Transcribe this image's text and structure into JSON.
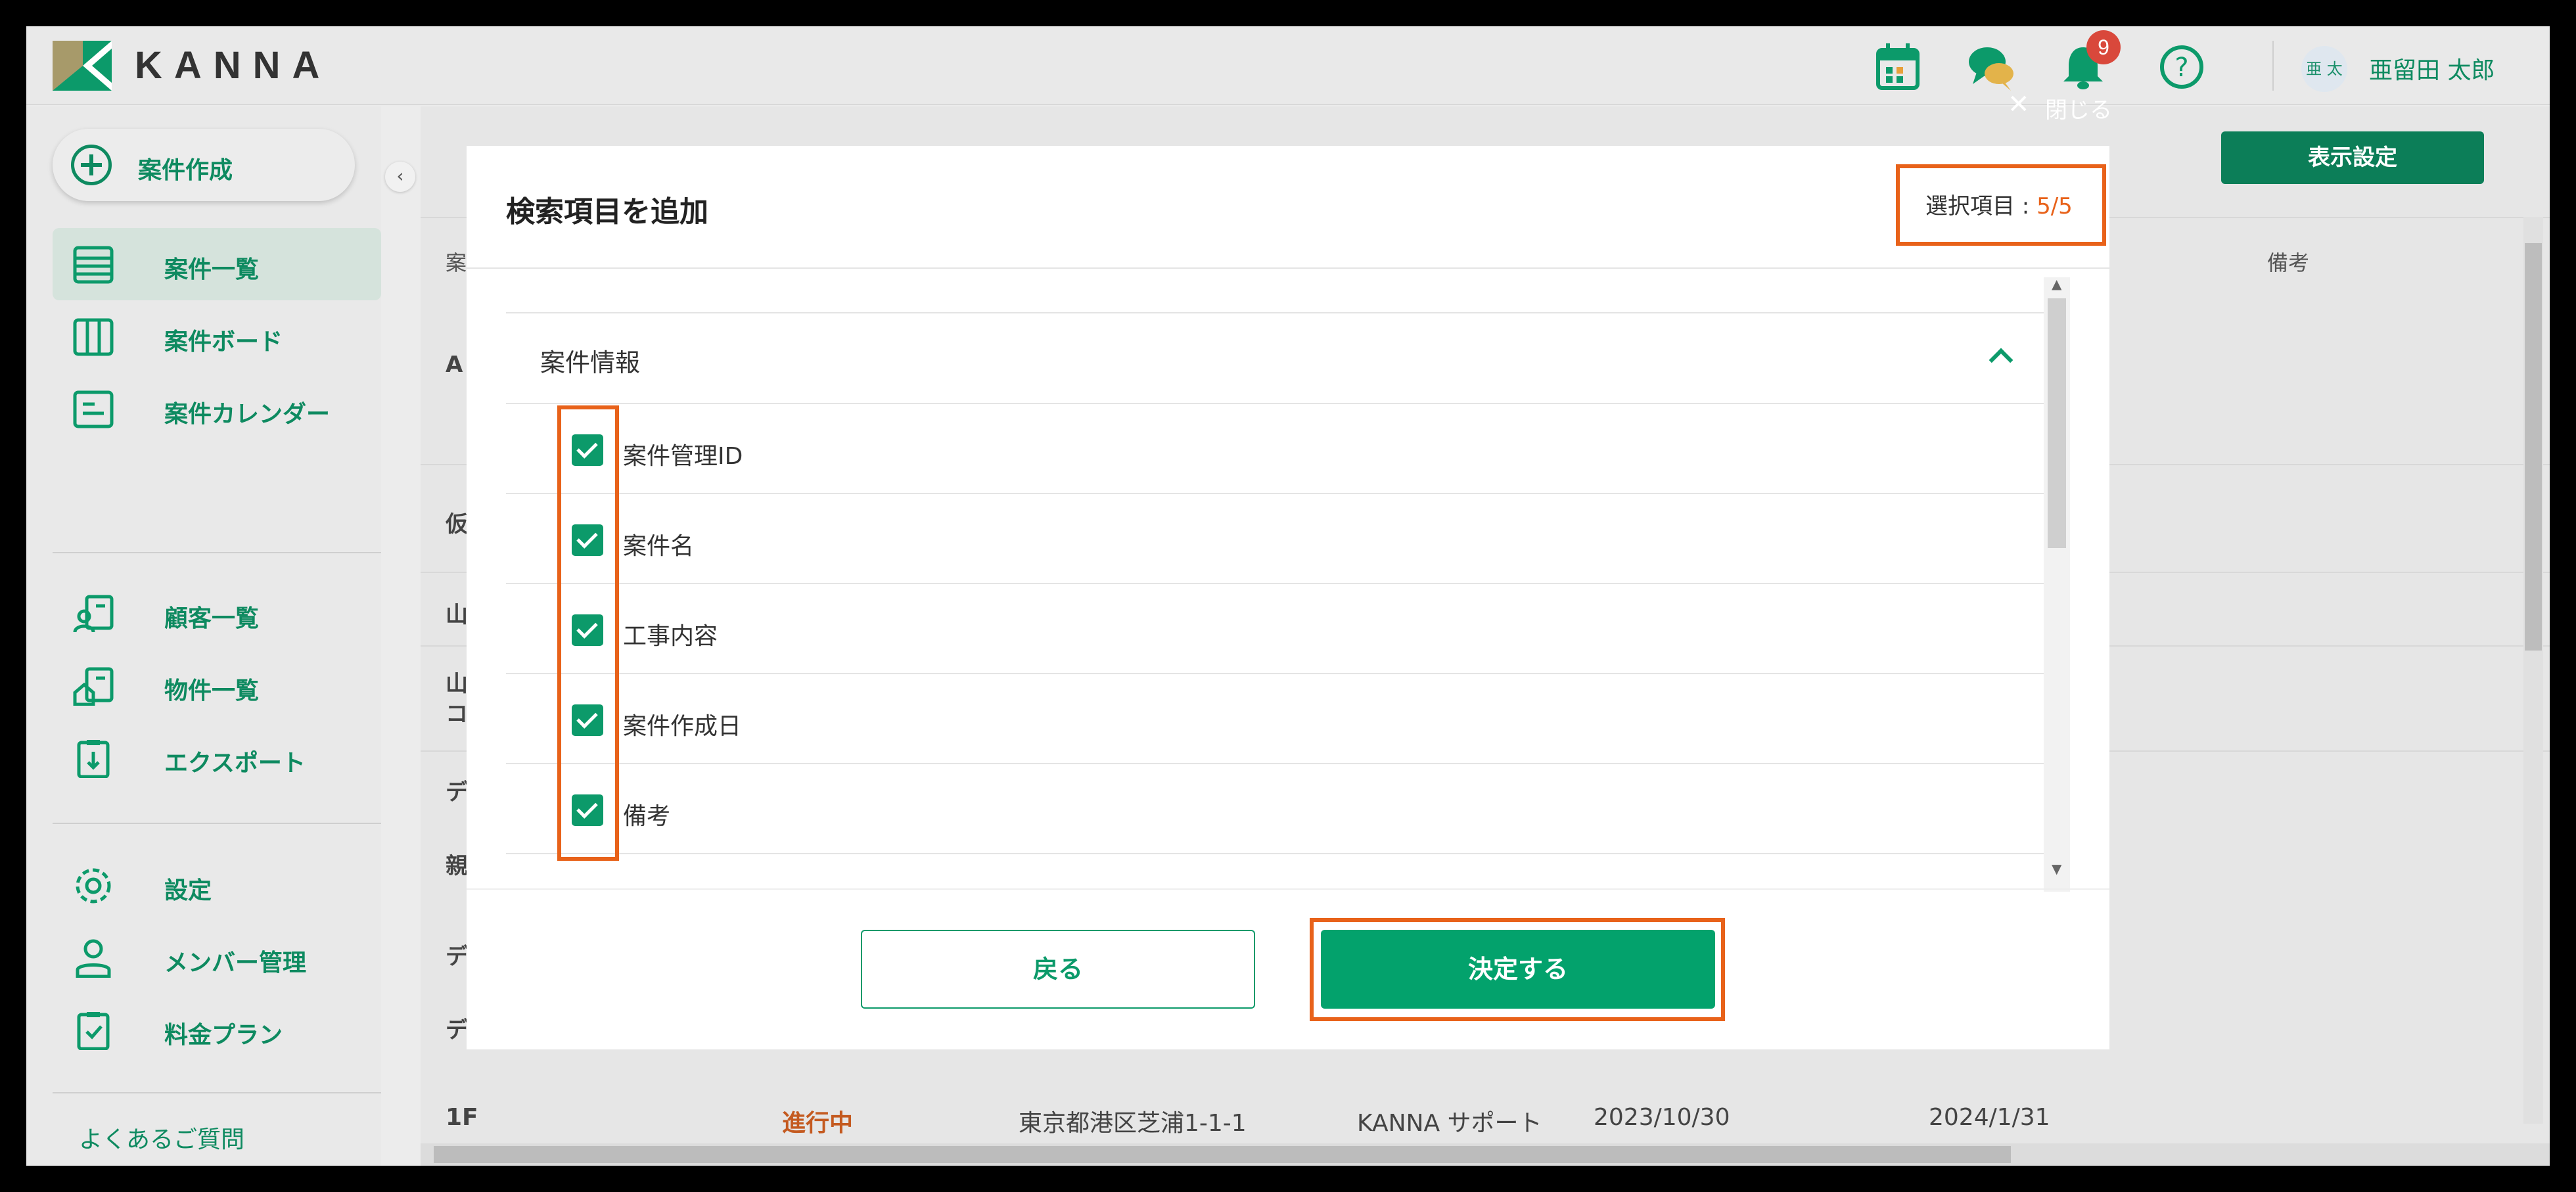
{
  "app": {
    "brand": "KANNA",
    "notification_count": "9",
    "user": {
      "avatar": "亜 太",
      "name": "亜留田 太郎"
    }
  },
  "sidebar": {
    "create": "案件作成",
    "items": [
      {
        "label": "案件一覧",
        "icon": "list-icon"
      },
      {
        "label": "案件ボード",
        "icon": "board-icon"
      },
      {
        "label": "案件カレンダー",
        "icon": "calendar-list-icon"
      },
      {
        "label": "顧客一覧",
        "icon": "customer-icon"
      },
      {
        "label": "物件一覧",
        "icon": "property-icon"
      },
      {
        "label": "エクスポート",
        "icon": "export-icon"
      },
      {
        "label": "設定",
        "icon": "gear-icon"
      },
      {
        "label": "メンバー管理",
        "icon": "person-icon"
      },
      {
        "label": "料金プラン",
        "icon": "plan-icon"
      }
    ],
    "faq": "よくあるご質問",
    "collapse": "‹"
  },
  "background": {
    "display_setting": "表示設定",
    "col_project": "案",
    "col_note": "備考",
    "row_prefixes": [
      "A",
      "仮",
      "山",
      "山\nコ",
      "デ",
      "親",
      "デ",
      "デ"
    ],
    "last_row": {
      "name": "1F",
      "status": "進行中",
      "address": "東京都港区芝浦1-1-1",
      "owner": "KANNA サポート",
      "date1": "2023/10/30",
      "date2": "2024/1/31"
    }
  },
  "modal": {
    "close": "閉じる",
    "title": "検索項目を追加",
    "selected_label": "選択項目 : ",
    "selected_count": "5/5",
    "section": "案件情報",
    "options": [
      "案件管理ID",
      "案件名",
      "工事内容",
      "案件作成日",
      "備考"
    ],
    "back": "戻る",
    "confirm": "決定する"
  },
  "colors": {
    "brand": "#0c9a6a",
    "highlight": "#e8621a",
    "badge": "#d9483b"
  }
}
